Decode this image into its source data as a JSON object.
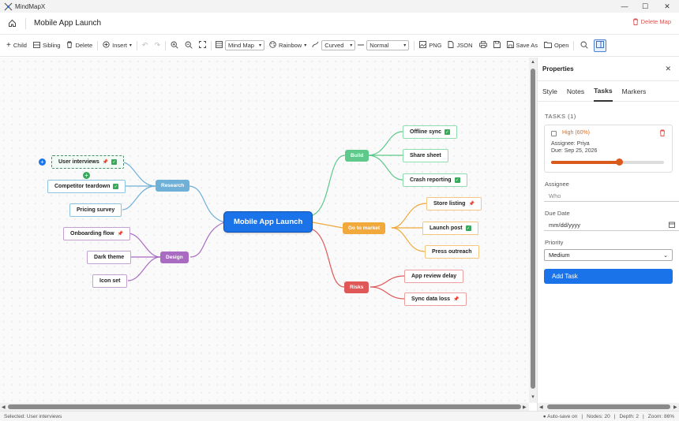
{
  "app": {
    "title": "MindMapX"
  },
  "header": {
    "doc_title": "Mobile App Launch",
    "delete_label": "Delete Map"
  },
  "toolbar": {
    "child": "Child",
    "sibling": "Sibling",
    "delete": "Delete",
    "insert": "Insert",
    "layout": "Mind Map",
    "theme": "Rainbow",
    "edge": "Curved",
    "weight": "Normal",
    "png": "PNG",
    "json": "JSON",
    "save_as": "Save As",
    "open": "Open"
  },
  "map": {
    "root": "Mobile App Launch",
    "branches": {
      "research": "Research",
      "design": "Design",
      "build": "Build",
      "gtm": "Go to market",
      "risks": "Risks"
    },
    "leaves": {
      "user_interviews": "User interviews",
      "competitor": "Competitor teardown",
      "pricing": "Pricing survey",
      "onboarding": "Onboarding flow",
      "dark_theme": "Dark theme",
      "icon_set": "Icon set",
      "offline": "Offline sync",
      "share": "Share sheet",
      "crash": "Crash reporting",
      "store": "Store listing",
      "launch": "Launch post",
      "press": "Press outreach",
      "review": "App review delay",
      "sync_loss": "Sync data loss"
    },
    "colors": {
      "research": "#6fb0d8",
      "design": "#a96bc1",
      "build": "#5ec98a",
      "gtm": "#f0a93a",
      "risks": "#e05757",
      "root": "#1a73e8"
    }
  },
  "panel": {
    "title": "Properties",
    "tabs": [
      "Style",
      "Notes",
      "Tasks",
      "Markers"
    ],
    "tasks_header": "TASKS (1)",
    "task": {
      "priority": "High (60%)",
      "assignee": "Assignee: Priya",
      "due": "Due: Sep 25, 2026",
      "progress": 0.6
    },
    "assignee_label": "Assignee",
    "assignee_placeholder": "Who",
    "due_label": "Due Date",
    "due_placeholder": "mm/dd/yyyy",
    "priority_label": "Priority",
    "priority_value": "Medium",
    "add_task": "Add Task"
  },
  "status": {
    "selected": "Selected: User interviews",
    "autosave": "Auto-save on",
    "nodes": "Nodes: 20",
    "depth": "Depth: 2",
    "zoom": "Zoom: 86%"
  }
}
